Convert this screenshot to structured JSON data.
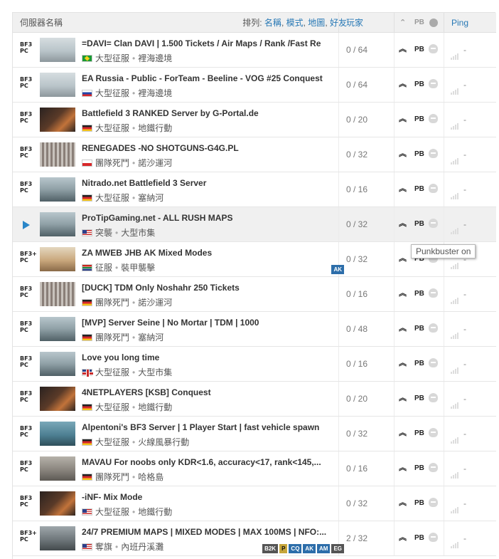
{
  "header": {
    "server_name": "伺服器名稱",
    "sort_label": "排列:",
    "sort_options": [
      "名稱",
      "模式",
      "地圖",
      "好友"
    ],
    "players": "玩家",
    "pb_icon": "PB",
    "ping": "Ping"
  },
  "tooltip": "Punkbuster on",
  "rows": [
    {
      "platform": [
        "BF3",
        "PC"
      ],
      "thumb": "jet",
      "title": "=DAVI= Clan DAVI | 1.500 Tickets / Air Maps / Rank /Fast Re",
      "flag": "br",
      "mode": "大型征服",
      "map": "裡海邊境",
      "players": "0 / 64",
      "pb": "PB",
      "ping": "-",
      "tags": []
    },
    {
      "platform": [
        "BF3",
        "PC"
      ],
      "thumb": "jet",
      "title": "EA Russia - Public - ForTeam - Beeline - VOG #25 Conquest",
      "flag": "ru",
      "mode": "大型征服",
      "map": "裡海邊境",
      "players": "0 / 64",
      "pb": "PB",
      "ping": "-",
      "tags": []
    },
    {
      "platform": [
        "BF3",
        "PC"
      ],
      "thumb": "dark",
      "title": "Battlefield 3 RANKED Server by G-Portal.de",
      "flag": "de",
      "mode": "大型征服",
      "map": "地鐵行動",
      "players": "0 / 20",
      "pb": "PB",
      "ping": "-",
      "tags": []
    },
    {
      "platform": [
        "BF3",
        "PC"
      ],
      "thumb": "grid",
      "title": "RENEGADES -NO SHOTGUNS-G4G.PL",
      "flag": "pl",
      "mode": "團隊死鬥",
      "map": "諾沙運河",
      "players": "0 / 32",
      "pb": "PB",
      "ping": "-",
      "tags": []
    },
    {
      "platform": [
        "BF3",
        "PC"
      ],
      "thumb": "bridge",
      "title": "Nitrado.net Battlefield 3 Server",
      "flag": "de",
      "mode": "大型征服",
      "map": "塞納河",
      "players": "0 / 16",
      "pb": "PB",
      "ping": "-",
      "tags": []
    },
    {
      "platform": [],
      "play": true,
      "thumb": "bridge",
      "title": "ProTipGaming.net - ALL RUSH MAPS",
      "flag": "us",
      "mode": "突襲",
      "map": "大型市集",
      "players": "0 / 32",
      "pb": "PB",
      "ping": "-",
      "tags": []
    },
    {
      "platform": [
        "BF3+",
        "PC"
      ],
      "thumb": "desert",
      "title": "ZA MWEB JHB AK Mixed Modes",
      "flag": "za",
      "mode": "征服",
      "map": "裝甲襲擊",
      "players": "0 / 32",
      "pb": "PB",
      "ping": "-",
      "tags": [
        "AK"
      ]
    },
    {
      "platform": [
        "BF3",
        "PC"
      ],
      "thumb": "grid",
      "title": "[DUCK] TDM Only Noshahr 250 Tickets",
      "flag": "de",
      "mode": "團隊死鬥",
      "map": "諾沙運河",
      "players": "0 / 16",
      "pb": "PB",
      "ping": "-",
      "tags": []
    },
    {
      "platform": [
        "BF3",
        "PC"
      ],
      "thumb": "bridge",
      "title": "[MVP] Server Seine | No Mortar | TDM | 1000",
      "flag": "de",
      "mode": "團隊死鬥",
      "map": "塞納河",
      "players": "0 / 48",
      "pb": "PB",
      "ping": "-",
      "tags": []
    },
    {
      "platform": [
        "BF3",
        "PC"
      ],
      "thumb": "bridge",
      "title": "Love you long time",
      "flag": "gb",
      "mode": "大型征服",
      "map": "大型市集",
      "players": "0 / 16",
      "pb": "PB",
      "ping": "-",
      "tags": []
    },
    {
      "platform": [
        "BF3",
        "PC"
      ],
      "thumb": "dark",
      "title": "4NETPLAYERS [KSB] Conquest",
      "flag": "de",
      "mode": "大型征服",
      "map": "地鐵行動",
      "players": "0 / 20",
      "pb": "PB",
      "ping": "-",
      "tags": []
    },
    {
      "platform": [
        "BF3",
        "PC"
      ],
      "thumb": "water",
      "title": "Alpentoni's BF3 Server | 1 Player Start | fast vehicle spawn",
      "flag": "de",
      "mode": "大型征服",
      "map": "火線風暴行動",
      "players": "0 / 32",
      "pb": "PB",
      "ping": "-",
      "tags": []
    },
    {
      "platform": [
        "BF3",
        "PC"
      ],
      "thumb": "stone",
      "title": "MAVAU For noobs only KDR<1.6, accuracy<17, rank<145,...",
      "flag": "de",
      "mode": "團隊死鬥",
      "map": "哈格島",
      "players": "0 / 16",
      "pb": "PB",
      "ping": "-",
      "tags": []
    },
    {
      "platform": [
        "BF3",
        "PC"
      ],
      "thumb": "dark",
      "title": "-iNF- Mix Mode",
      "flag": "us",
      "mode": "大型征服",
      "map": "地鐵行動",
      "players": "0 / 32",
      "pb": "PB",
      "ping": "-",
      "tags": []
    },
    {
      "platform": [
        "BF3+",
        "PC"
      ],
      "thumb": "city",
      "title": "24/7 PREMIUM MAPS | MIXED MODES | MAX 100MS | NFO:...",
      "flag": "us",
      "mode": "奪旗",
      "map": "內班丹溪灘",
      "players": "2 / 32",
      "pb": "PB",
      "ping": "-",
      "tags": [
        "B2K",
        "P",
        "CQ",
        "AK",
        "AM",
        "EG"
      ]
    }
  ]
}
